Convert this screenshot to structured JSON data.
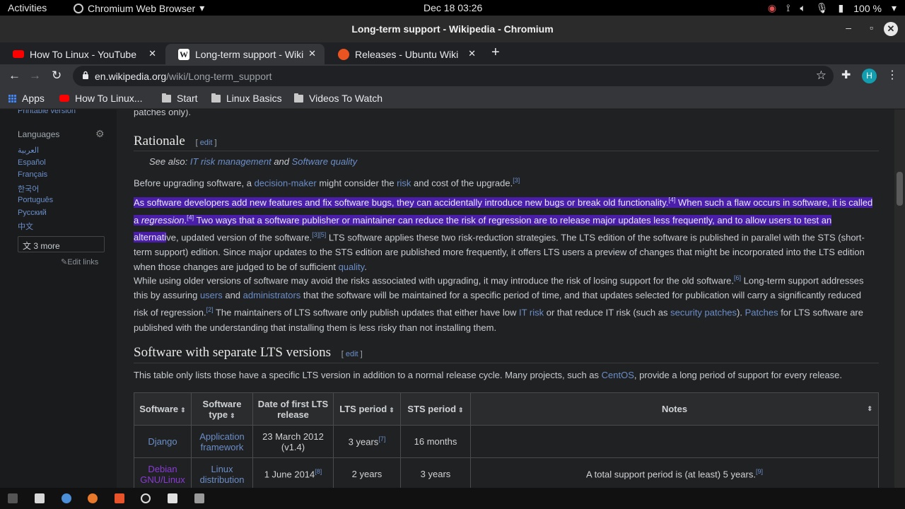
{
  "topbar": {
    "activities": "Activities",
    "app_menu": "Chromium Web Browser",
    "clock": "Dec 18  03:26",
    "battery": "100 %"
  },
  "window": {
    "title": "Long-term support - Wikipedia - Chromium"
  },
  "tabs": [
    {
      "label": "How To Linux - YouTube",
      "favicon_color": "#ff0000"
    },
    {
      "label": "Long-term support - Wiki",
      "favicon_color": "#ffffff"
    },
    {
      "label": "Releases - Ubuntu Wiki",
      "favicon_color": "#e95420"
    }
  ],
  "toolbar": {
    "url_host": "en.wikipedia.org",
    "url_path": "/wiki/Long-term_support",
    "avatar_letter": "H"
  },
  "bookmarks": {
    "apps": "Apps",
    "items": [
      "How To Linux...",
      "Start",
      "Linux Basics",
      "Videos To Watch"
    ]
  },
  "sidebar": {
    "printable": "Printable version",
    "languages_heading": "Languages",
    "languages": [
      "العربية",
      "Español",
      "Français",
      "한국어",
      "Português",
      "Русский",
      "中文"
    ],
    "more": "3 more",
    "edit_links": "Edit links"
  },
  "article": {
    "top_fragment": "patches only).",
    "h_rationale": "Rationale",
    "edit": "edit",
    "see_also_prefix": "See also: ",
    "see_also_link1": "IT risk management",
    "see_also_and": " and ",
    "see_also_link2": "Software quality",
    "p1_a": "Before upgrading software, a ",
    "p1_link1": "decision-maker",
    "p1_b": " might consider the ",
    "p1_link2": "risk",
    "p1_c": " and cost of the upgrade.",
    "p1_ref": "[3]",
    "p2_sel1": "As software developers add new features and fix software bugs, they can accidentally introduce new bugs or break old functionality.",
    "p2_ref1": "[4]",
    "p2_sel2": " When such a flaw occurs in software, it is called a ",
    "p2_sel_italic": "regression",
    "p2_sel3": ".",
    "p2_ref2": "[4]",
    "p2_sel4": " Two ways that a software publisher or maintainer can reduce the risk of regression are to release major updates less frequently, and to allow users to test an alternati",
    "p2_rest1": "ve, updated version of the software.",
    "p2_ref3": "[3][5]",
    "p2_rest2": " LTS software applies these two risk-reduction strategies. The LTS edition of the software is published in parallel with the STS (short-term support) edition. Since major updates to the STS edition are published more frequently, it offers LTS users a preview of changes that might be incorporated into the LTS edition when those changes are judged to be of sufficient ",
    "p2_link": "quality",
    "p2_end": ".",
    "p3_a": "While using older versions of software may avoid the risks associated with upgrading, it may introduce the risk of losing support for the old software.",
    "p3_ref1": "[6]",
    "p3_b": " Long-term support addresses this by assuring ",
    "p3_link1": "users",
    "p3_c": " and ",
    "p3_link2": "administrators",
    "p3_d": " that the software will be maintained for a specific period of time, and that updates selected for publication will carry a significantly reduced risk of regression.",
    "p3_ref2": "[2]",
    "p3_e": " The maintainers of LTS software only publish updates that either have low ",
    "p3_link3": "IT risk",
    "p3_f": " or that reduce IT risk (such as ",
    "p3_link4": "security patches",
    "p3_g": "). ",
    "p3_link5": "Patches",
    "p3_h": " for LTS software are published with the understanding that installing them is less risky than not installing them.",
    "h_sep": "Software with separate LTS versions",
    "p4_a": "This table only lists those have a specific LTS version in addition to a normal release cycle. Many projects, such as ",
    "p4_link": "CentOS",
    "p4_b": ", provide a long period of support for every release."
  },
  "table": {
    "headers": [
      "Software",
      "Software type",
      "Date of first LTS release",
      "LTS period",
      "STS period",
      "Notes"
    ],
    "rows": [
      {
        "software": "Django",
        "type": "Application framework",
        "date": "23 March 2012 (v1.4)",
        "date_ref": "",
        "lts": "3 years",
        "lts_ref": "[7]",
        "sts": "16 months",
        "notes": "",
        "notes_ref": ""
      },
      {
        "software": "Debian GNU/Linux",
        "type": "Linux distribution",
        "date": "1 June 2014",
        "date_ref": "[8]",
        "lts": "2 years",
        "lts_ref": "",
        "sts": "3 years",
        "notes": "A total support period is (at least) 5 years.",
        "notes_ref": "[9]"
      }
    ]
  }
}
